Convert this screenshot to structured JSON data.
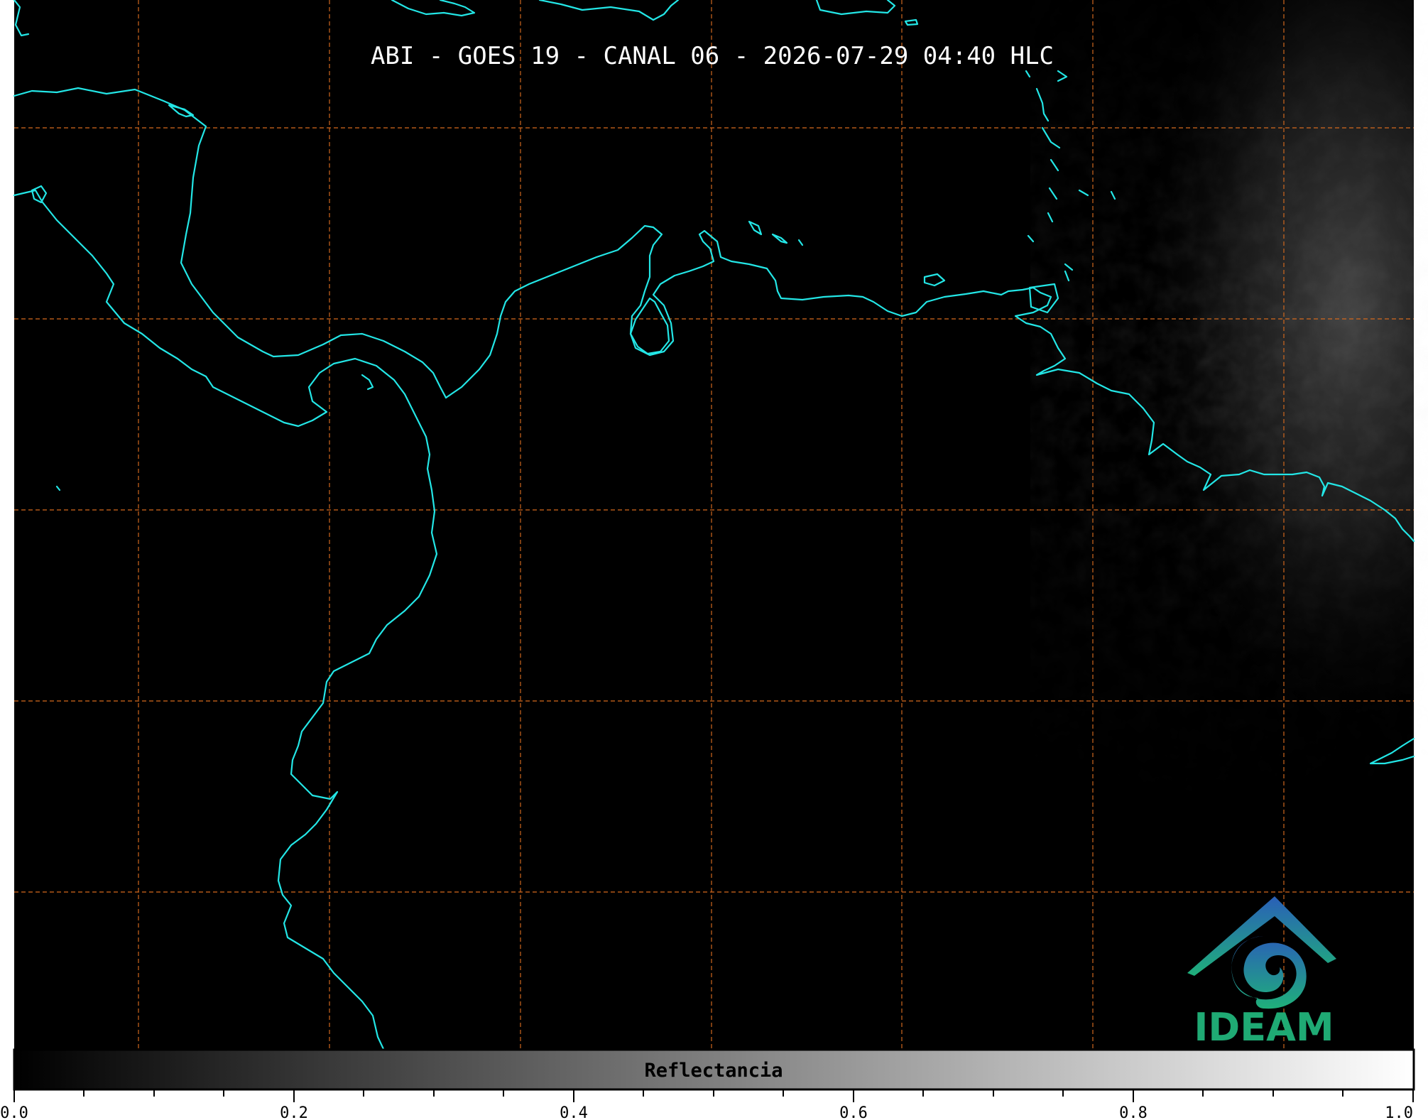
{
  "map": {
    "title": "ABI - GOES 19 - CANAL 06 - 2026-07-29 04:40 HLC",
    "background_color": "#000000",
    "coastline_color": "#23e6e6",
    "gridline_color": "#d2691e",
    "gridlines": "dashed lat/lon grid",
    "features": [
      "coastline-central-america",
      "coastline-caribbean",
      "coastline-venezuela",
      "islands",
      "cloud-texture-east"
    ]
  },
  "colorbar": {
    "label": "Reflectancia",
    "range": [
      0.0,
      1.0
    ],
    "ticks": [
      "0.0",
      "0.2",
      "0.4",
      "0.6",
      "0.8",
      "1.0"
    ],
    "gradient": [
      "#000000",
      "#ffffff"
    ]
  },
  "logo": {
    "text": "IDEAM",
    "color": "#1faa74"
  }
}
